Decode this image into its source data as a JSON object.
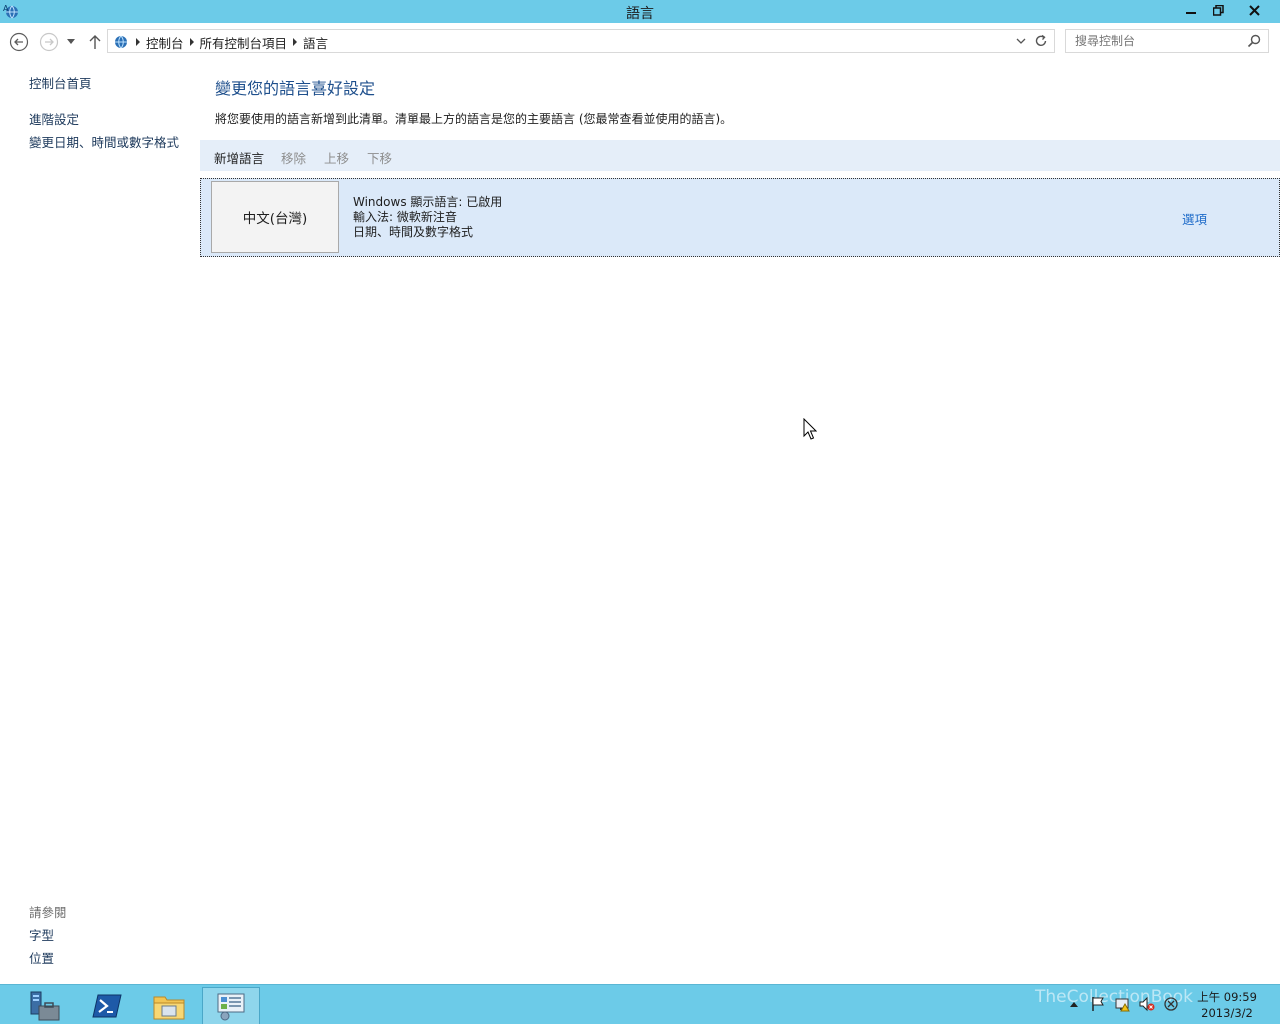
{
  "window": {
    "title": "語言",
    "icon": "language-globe-icon"
  },
  "nav": {
    "breadcrumb": [
      "控制台",
      "所有控制台項目",
      "語言"
    ],
    "search_placeholder": "搜尋控制台"
  },
  "sidebar": {
    "home": "控制台首頁",
    "links": [
      "進階設定",
      "變更日期、時間或數字格式"
    ],
    "see_also_label": "請參閱",
    "see_also": [
      "字型",
      "位置"
    ]
  },
  "main": {
    "heading": "變更您的語言喜好設定",
    "description": "將您要使用的語言新增到此清單。清單最上方的語言是您的主要語言 (您最常查看並使用的語言)。",
    "toolbar": {
      "add": "新增語言",
      "remove": "移除",
      "move_up": "上移",
      "move_down": "下移"
    },
    "languages": [
      {
        "name": "中文(台灣)",
        "details": [
          "Windows 顯示語言: 已啟用",
          "輸入法: 微軟新注音",
          "日期、時間及數字格式"
        ],
        "options": "選項"
      }
    ]
  },
  "taskbar": {
    "apps": [
      "server-manager-icon",
      "powershell-icon",
      "file-explorer-icon",
      "control-panel-icon"
    ],
    "clock_time": "上午 09:59",
    "clock_date": "2013/3/2",
    "watermark": "TheCollectionBook"
  },
  "colors": {
    "titlebar": "#6ccbe8",
    "accent_link": "#1e6bc9",
    "heading": "#1e4f8c",
    "toolbar_bg": "#e5eef9",
    "selected_row": "#dbe9f9"
  }
}
